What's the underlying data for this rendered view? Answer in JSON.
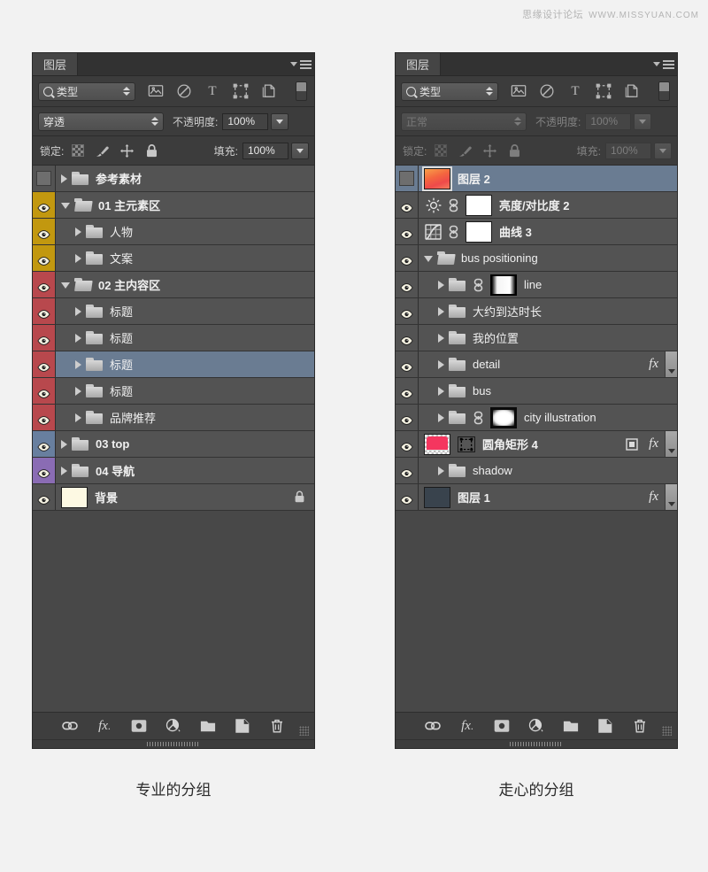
{
  "watermark": {
    "text": "思缘设计论坛",
    "url": "WWW.MISSYUAN.COM"
  },
  "panels": [
    {
      "id": "left",
      "tab_label": "图层",
      "caption": "专业的分组",
      "filter": {
        "type_label": "类型",
        "icons": [
          "image-filter-icon",
          "adjustment-filter-icon",
          "text-filter-icon",
          "shape-filter-icon",
          "smartobject-filter-icon"
        ],
        "toggle": "filter-toggle"
      },
      "blend": {
        "mode": "穿透",
        "opacity_label": "不透明度:",
        "opacity_value": "100%",
        "disabled": false
      },
      "lock": {
        "label": "锁定:",
        "fill_label": "填充:",
        "fill_value": "100%",
        "icons": [
          "lock-transparent-icon",
          "lock-image-icon",
          "lock-position-icon",
          "lock-all-icon"
        ],
        "disabled": false
      },
      "layers": [
        {
          "name": "参考素材",
          "kind": "group",
          "expanded": false,
          "visible": false,
          "indent": 0,
          "color": "none",
          "selected": false,
          "bold": true
        },
        {
          "name": "01 主元素区",
          "kind": "group",
          "expanded": true,
          "visible": true,
          "indent": 0,
          "color": "yellow",
          "selected": false,
          "bold": true
        },
        {
          "name": "人物",
          "kind": "group",
          "expanded": false,
          "visible": true,
          "indent": 1,
          "color": "yellow",
          "selected": false,
          "bold": false
        },
        {
          "name": "文案",
          "kind": "group",
          "expanded": false,
          "visible": true,
          "indent": 1,
          "color": "yellow",
          "selected": false,
          "bold": false
        },
        {
          "name": "02 主内容区",
          "kind": "group",
          "expanded": true,
          "visible": true,
          "indent": 0,
          "color": "red",
          "selected": false,
          "bold": true
        },
        {
          "name": "标题",
          "kind": "group",
          "expanded": false,
          "visible": true,
          "indent": 1,
          "color": "red",
          "selected": false,
          "bold": false
        },
        {
          "name": "标题",
          "kind": "group",
          "expanded": false,
          "visible": true,
          "indent": 1,
          "color": "red",
          "selected": false,
          "bold": false
        },
        {
          "name": "标题",
          "kind": "group",
          "expanded": false,
          "visible": true,
          "indent": 1,
          "color": "red",
          "selected": true,
          "bold": false
        },
        {
          "name": "标题",
          "kind": "group",
          "expanded": false,
          "visible": true,
          "indent": 1,
          "color": "red",
          "selected": false,
          "bold": false
        },
        {
          "name": "品牌推荐",
          "kind": "group",
          "expanded": false,
          "visible": true,
          "indent": 1,
          "color": "red",
          "selected": false,
          "bold": false
        },
        {
          "name": "03 top",
          "kind": "group",
          "expanded": false,
          "visible": true,
          "indent": 0,
          "color": "blue",
          "selected": false,
          "bold": true
        },
        {
          "name": "04 导航",
          "kind": "group",
          "expanded": false,
          "visible": true,
          "indent": 0,
          "color": "purple",
          "selected": false,
          "bold": true
        },
        {
          "name": "背景",
          "kind": "background",
          "expanded": null,
          "visible": true,
          "indent": 0,
          "color": "none",
          "selected": false,
          "bold": true,
          "thumb": "cream",
          "locked": true
        }
      ],
      "toolbar": [
        "link-layers-icon",
        "layer-style-fx-icon",
        "add-mask-icon",
        "new-adjustment-icon",
        "new-group-icon",
        "new-layer-icon",
        "delete-layer-icon"
      ]
    },
    {
      "id": "right",
      "tab_label": "图层",
      "caption": "走心的分组",
      "filter": {
        "type_label": "类型",
        "icons": [
          "image-filter-icon",
          "adjustment-filter-icon",
          "text-filter-icon",
          "shape-filter-icon",
          "smartobject-filter-icon"
        ],
        "toggle": "filter-toggle"
      },
      "blend": {
        "mode": "正常",
        "opacity_label": "不透明度:",
        "opacity_value": "100%",
        "disabled": true
      },
      "lock": {
        "label": "锁定:",
        "fill_label": "填充:",
        "fill_value": "100%",
        "icons": [
          "lock-transparent-icon",
          "lock-image-icon",
          "lock-position-icon",
          "lock-all-icon"
        ],
        "disabled": true
      },
      "layers": [
        {
          "name": "图层 2",
          "kind": "image",
          "visible": false,
          "indent": 0,
          "selected": true,
          "bold": true,
          "thumb": "photo",
          "thumb_selected": true
        },
        {
          "name": "亮度/对比度 2",
          "kind": "adjustment",
          "adj_icon": "brightness-contrast-icon",
          "visible": true,
          "indent": 0,
          "selected": false,
          "bold": true,
          "thumb": "white",
          "linked": true
        },
        {
          "name": "曲线 3",
          "kind": "adjustment",
          "adj_icon": "curves-icon",
          "visible": true,
          "indent": 0,
          "selected": false,
          "bold": true,
          "thumb": "white",
          "linked": true
        },
        {
          "name": "bus positioning",
          "kind": "group",
          "expanded": true,
          "visible": true,
          "indent": 0,
          "selected": false,
          "bold": false
        },
        {
          "name": "line",
          "kind": "group",
          "expanded": false,
          "visible": true,
          "indent": 1,
          "selected": false,
          "bold": false,
          "thumb": "grad-mask",
          "linked": true
        },
        {
          "name": "大约到达时长",
          "kind": "group",
          "expanded": false,
          "visible": true,
          "indent": 1,
          "selected": false,
          "bold": false
        },
        {
          "name": "我的位置",
          "kind": "group",
          "expanded": false,
          "visible": true,
          "indent": 1,
          "selected": false,
          "bold": false
        },
        {
          "name": "detail",
          "kind": "group",
          "expanded": false,
          "visible": true,
          "indent": 1,
          "selected": false,
          "bold": false,
          "fx": true,
          "expander": true
        },
        {
          "name": "bus",
          "kind": "group",
          "expanded": false,
          "visible": true,
          "indent": 1,
          "selected": false,
          "bold": false
        },
        {
          "name": "city illustration",
          "kind": "group",
          "expanded": false,
          "visible": true,
          "indent": 1,
          "selected": false,
          "bold": false,
          "thumb": "city-mask",
          "linked": true
        },
        {
          "name": "圆角矩形 4",
          "kind": "shape",
          "visible": true,
          "indent": 0,
          "selected": false,
          "bold": true,
          "thumb": "pink",
          "vector_mask": true,
          "fx": true,
          "expander": true
        },
        {
          "name": "shadow",
          "kind": "group",
          "expanded": false,
          "visible": true,
          "indent": 1,
          "selected": false,
          "bold": false
        },
        {
          "name": "图层 1",
          "kind": "image",
          "visible": true,
          "indent": 0,
          "selected": false,
          "bold": true,
          "thumb": "dark",
          "fx": true,
          "expander": true
        }
      ],
      "toolbar": [
        "link-layers-icon",
        "layer-style-fx-icon",
        "add-mask-icon",
        "new-adjustment-icon",
        "new-group-icon",
        "new-layer-icon",
        "delete-layer-icon"
      ]
    }
  ],
  "colors": {
    "yellow": "#c2980f",
    "red": "#b8484d",
    "blue": "#687f9f",
    "purple": "#8a6cb4",
    "selection": "#6a7c92",
    "panel_bg": "#3c3c3c",
    "row_bg": "#535353",
    "page_bg": "#f2f2f2"
  }
}
